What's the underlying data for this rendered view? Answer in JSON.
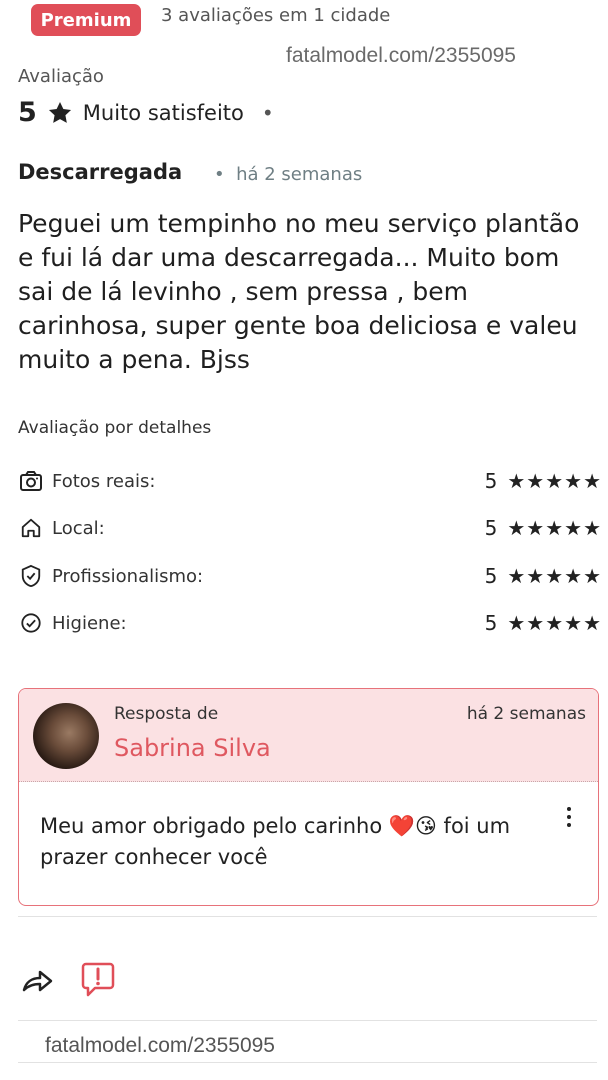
{
  "header": {
    "badge": "Premium",
    "summary": "3 avaliações em 1 cidade",
    "watermark": "fatalmodel.com/2355095"
  },
  "review": {
    "section_label": "Avaliação",
    "score": "5",
    "sentiment": "Muito satisfeito",
    "separator": "•",
    "title": "Descarregada",
    "time": "há 2 semanas",
    "time_bullet": "•",
    "body": "Peguei um tempinho no meu serviço plantão e fui lá dar uma descarregada... Muito bom sai de lá levinho , sem pressa , bem carinhosa, super gente boa deliciosa e valeu muito a pena. Bjss"
  },
  "details": {
    "heading": "Avaliação por detalhes",
    "items": [
      {
        "icon": "camera-icon",
        "label": "Fotos reais:",
        "value": "5",
        "stars": "★★★★★"
      },
      {
        "icon": "home-icon",
        "label": "Local:",
        "value": "5",
        "stars": "★★★★★"
      },
      {
        "icon": "shield-icon",
        "label": "Profissionalismo:",
        "value": "5",
        "stars": "★★★★★"
      },
      {
        "icon": "check-circle-icon",
        "label": "Higiene:",
        "value": "5",
        "stars": "★★★★★"
      }
    ]
  },
  "reply": {
    "label": "Resposta de",
    "name": "Sabrina Silva",
    "time": "há 2 semanas",
    "text": "Meu amor obrigado pelo carinho ❤️😘 foi um prazer conhecer você"
  },
  "actions": {
    "share_icon": "share-icon",
    "report_icon": "report-icon"
  },
  "footer": {
    "watermark": "fatalmodel.com/2355095"
  },
  "colors": {
    "accent": "#e04e58",
    "reply_bg": "#fbe1e3",
    "reply_name": "#df5860"
  }
}
